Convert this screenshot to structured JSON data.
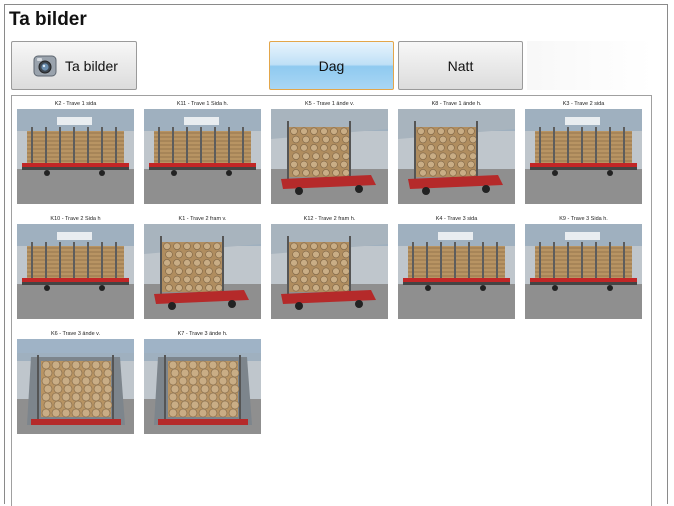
{
  "header": {
    "title": "Ta bilder"
  },
  "toolbar": {
    "capture_label": "Ta bilder",
    "day_label": "Dag",
    "night_label": "Natt",
    "active_mode": "Dag"
  },
  "colors": {
    "active_border": "#e3a64a",
    "active_fill": "#a9d6f4"
  },
  "thumbnails": [
    {
      "caption": "K2 - Trave 1 sida",
      "icon": "side-view"
    },
    {
      "caption": "K11 - Trave 1 Sida h.",
      "icon": "side-view"
    },
    {
      "caption": "K5 - Trave 1 ände v.",
      "icon": "angled-view"
    },
    {
      "caption": "K8 - Trave 1 ände h.",
      "icon": "angled-view"
    },
    {
      "caption": "K3 - Trave 2 sida",
      "icon": "side-view"
    },
    {
      "caption": "K10 - Trave 2 Sida h",
      "icon": "side-view"
    },
    {
      "caption": "K1 - Trave 2 fram v.",
      "icon": "angled-view"
    },
    {
      "caption": "K12 - Trave 2 fram h.",
      "icon": "angled-view"
    },
    {
      "caption": "K4 - Trave 3 sida",
      "icon": "side-view"
    },
    {
      "caption": "K9 - Trave 3 Sida h.",
      "icon": "side-view"
    },
    {
      "caption": "K6 - Trave 3 ände v.",
      "icon": "end-view"
    },
    {
      "caption": "K7 - Trave 3 ände h.",
      "icon": "end-view"
    }
  ]
}
